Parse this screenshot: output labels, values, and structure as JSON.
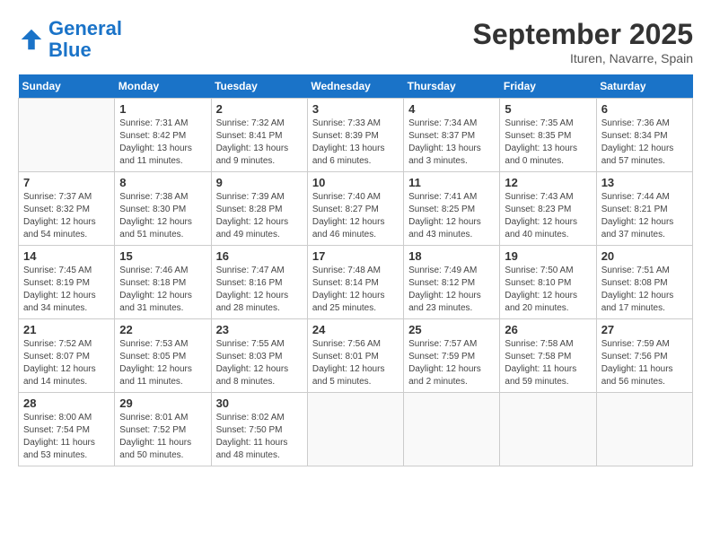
{
  "header": {
    "logo_line1": "General",
    "logo_line2": "Blue",
    "month_title": "September 2025",
    "location": "Ituren, Navarre, Spain"
  },
  "weekdays": [
    "Sunday",
    "Monday",
    "Tuesday",
    "Wednesday",
    "Thursday",
    "Friday",
    "Saturday"
  ],
  "weeks": [
    [
      {
        "day": "",
        "sunrise": "",
        "sunset": "",
        "daylight": ""
      },
      {
        "day": "1",
        "sunrise": "Sunrise: 7:31 AM",
        "sunset": "Sunset: 8:42 PM",
        "daylight": "Daylight: 13 hours and 11 minutes."
      },
      {
        "day": "2",
        "sunrise": "Sunrise: 7:32 AM",
        "sunset": "Sunset: 8:41 PM",
        "daylight": "Daylight: 13 hours and 9 minutes."
      },
      {
        "day": "3",
        "sunrise": "Sunrise: 7:33 AM",
        "sunset": "Sunset: 8:39 PM",
        "daylight": "Daylight: 13 hours and 6 minutes."
      },
      {
        "day": "4",
        "sunrise": "Sunrise: 7:34 AM",
        "sunset": "Sunset: 8:37 PM",
        "daylight": "Daylight: 13 hours and 3 minutes."
      },
      {
        "day": "5",
        "sunrise": "Sunrise: 7:35 AM",
        "sunset": "Sunset: 8:35 PM",
        "daylight": "Daylight: 13 hours and 0 minutes."
      },
      {
        "day": "6",
        "sunrise": "Sunrise: 7:36 AM",
        "sunset": "Sunset: 8:34 PM",
        "daylight": "Daylight: 12 hours and 57 minutes."
      }
    ],
    [
      {
        "day": "7",
        "sunrise": "Sunrise: 7:37 AM",
        "sunset": "Sunset: 8:32 PM",
        "daylight": "Daylight: 12 hours and 54 minutes."
      },
      {
        "day": "8",
        "sunrise": "Sunrise: 7:38 AM",
        "sunset": "Sunset: 8:30 PM",
        "daylight": "Daylight: 12 hours and 51 minutes."
      },
      {
        "day": "9",
        "sunrise": "Sunrise: 7:39 AM",
        "sunset": "Sunset: 8:28 PM",
        "daylight": "Daylight: 12 hours and 49 minutes."
      },
      {
        "day": "10",
        "sunrise": "Sunrise: 7:40 AM",
        "sunset": "Sunset: 8:27 PM",
        "daylight": "Daylight: 12 hours and 46 minutes."
      },
      {
        "day": "11",
        "sunrise": "Sunrise: 7:41 AM",
        "sunset": "Sunset: 8:25 PM",
        "daylight": "Daylight: 12 hours and 43 minutes."
      },
      {
        "day": "12",
        "sunrise": "Sunrise: 7:43 AM",
        "sunset": "Sunset: 8:23 PM",
        "daylight": "Daylight: 12 hours and 40 minutes."
      },
      {
        "day": "13",
        "sunrise": "Sunrise: 7:44 AM",
        "sunset": "Sunset: 8:21 PM",
        "daylight": "Daylight: 12 hours and 37 minutes."
      }
    ],
    [
      {
        "day": "14",
        "sunrise": "Sunrise: 7:45 AM",
        "sunset": "Sunset: 8:19 PM",
        "daylight": "Daylight: 12 hours and 34 minutes."
      },
      {
        "day": "15",
        "sunrise": "Sunrise: 7:46 AM",
        "sunset": "Sunset: 8:18 PM",
        "daylight": "Daylight: 12 hours and 31 minutes."
      },
      {
        "day": "16",
        "sunrise": "Sunrise: 7:47 AM",
        "sunset": "Sunset: 8:16 PM",
        "daylight": "Daylight: 12 hours and 28 minutes."
      },
      {
        "day": "17",
        "sunrise": "Sunrise: 7:48 AM",
        "sunset": "Sunset: 8:14 PM",
        "daylight": "Daylight: 12 hours and 25 minutes."
      },
      {
        "day": "18",
        "sunrise": "Sunrise: 7:49 AM",
        "sunset": "Sunset: 8:12 PM",
        "daylight": "Daylight: 12 hours and 23 minutes."
      },
      {
        "day": "19",
        "sunrise": "Sunrise: 7:50 AM",
        "sunset": "Sunset: 8:10 PM",
        "daylight": "Daylight: 12 hours and 20 minutes."
      },
      {
        "day": "20",
        "sunrise": "Sunrise: 7:51 AM",
        "sunset": "Sunset: 8:08 PM",
        "daylight": "Daylight: 12 hours and 17 minutes."
      }
    ],
    [
      {
        "day": "21",
        "sunrise": "Sunrise: 7:52 AM",
        "sunset": "Sunset: 8:07 PM",
        "daylight": "Daylight: 12 hours and 14 minutes."
      },
      {
        "day": "22",
        "sunrise": "Sunrise: 7:53 AM",
        "sunset": "Sunset: 8:05 PM",
        "daylight": "Daylight: 12 hours and 11 minutes."
      },
      {
        "day": "23",
        "sunrise": "Sunrise: 7:55 AM",
        "sunset": "Sunset: 8:03 PM",
        "daylight": "Daylight: 12 hours and 8 minutes."
      },
      {
        "day": "24",
        "sunrise": "Sunrise: 7:56 AM",
        "sunset": "Sunset: 8:01 PM",
        "daylight": "Daylight: 12 hours and 5 minutes."
      },
      {
        "day": "25",
        "sunrise": "Sunrise: 7:57 AM",
        "sunset": "Sunset: 7:59 PM",
        "daylight": "Daylight: 12 hours and 2 minutes."
      },
      {
        "day": "26",
        "sunrise": "Sunrise: 7:58 AM",
        "sunset": "Sunset: 7:58 PM",
        "daylight": "Daylight: 11 hours and 59 minutes."
      },
      {
        "day": "27",
        "sunrise": "Sunrise: 7:59 AM",
        "sunset": "Sunset: 7:56 PM",
        "daylight": "Daylight: 11 hours and 56 minutes."
      }
    ],
    [
      {
        "day": "28",
        "sunrise": "Sunrise: 8:00 AM",
        "sunset": "Sunset: 7:54 PM",
        "daylight": "Daylight: 11 hours and 53 minutes."
      },
      {
        "day": "29",
        "sunrise": "Sunrise: 8:01 AM",
        "sunset": "Sunset: 7:52 PM",
        "daylight": "Daylight: 11 hours and 50 minutes."
      },
      {
        "day": "30",
        "sunrise": "Sunrise: 8:02 AM",
        "sunset": "Sunset: 7:50 PM",
        "daylight": "Daylight: 11 hours and 48 minutes."
      },
      {
        "day": "",
        "sunrise": "",
        "sunset": "",
        "daylight": ""
      },
      {
        "day": "",
        "sunrise": "",
        "sunset": "",
        "daylight": ""
      },
      {
        "day": "",
        "sunrise": "",
        "sunset": "",
        "daylight": ""
      },
      {
        "day": "",
        "sunrise": "",
        "sunset": "",
        "daylight": ""
      }
    ]
  ]
}
